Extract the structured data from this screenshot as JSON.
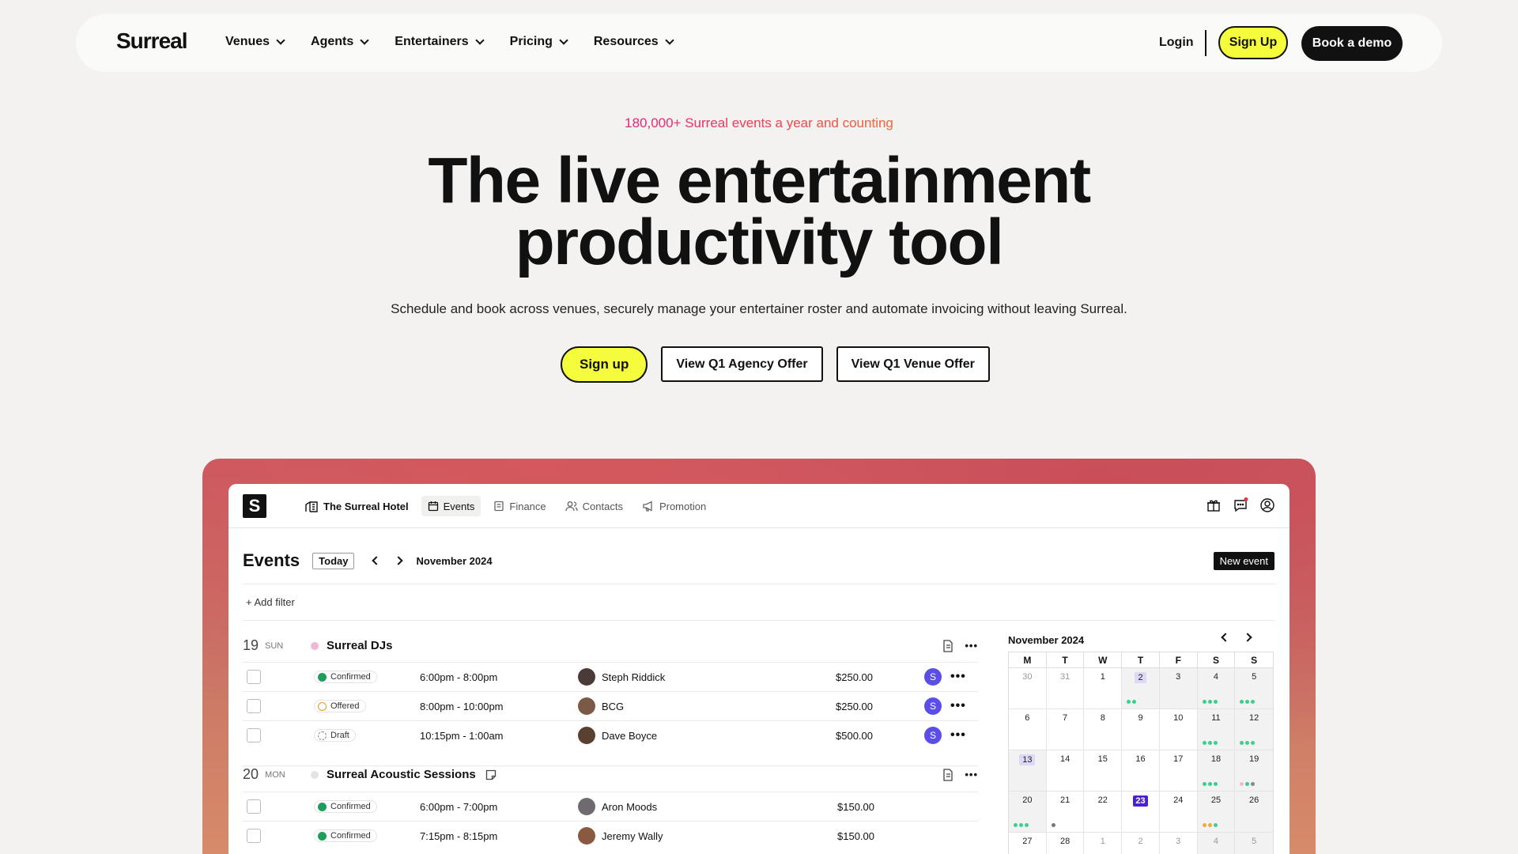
{
  "nav": {
    "logo": "Surreal",
    "items": [
      "Venues",
      "Agents",
      "Entertainers",
      "Pricing",
      "Resources"
    ],
    "login": "Login",
    "signup": "Sign Up",
    "demo": "Book a demo"
  },
  "hero": {
    "eyebrow": "180,000+ Surreal events a year and counting",
    "headline_1": "The live entertainment",
    "headline_2": "productivity tool",
    "sub": "Schedule and book across venues, securely manage your entertainer roster and automate invoicing without leaving Surreal.",
    "cta_signup": "Sign up",
    "cta_agency": "View Q1 Agency Offer",
    "cta_venue": "View Q1 Venue Offer"
  },
  "app": {
    "logo": "S",
    "venue": "The Surreal Hotel",
    "tabs": [
      "Events",
      "Finance",
      "Contacts",
      "Promotion"
    ],
    "events_title": "Events",
    "today": "Today",
    "month": "November 2024",
    "new_event": "New event",
    "add_filter": "+ Add filter",
    "days": [
      {
        "num": "19",
        "dow": "SUN",
        "name": "Surreal DJs",
        "dot": "#f4b6d8",
        "rows": [
          {
            "status": "Confirmed",
            "time": "6:00pm - 8:00pm",
            "person": "Steph Riddick",
            "price": "$250.00",
            "badge": "S"
          },
          {
            "status": "Offered",
            "time": "8:00pm - 10:00pm",
            "person": "BCG",
            "price": "$250.00",
            "badge": "S"
          },
          {
            "status": "Draft",
            "time": "10:15pm - 1:00am",
            "person": "Dave Boyce",
            "price": "$500.00",
            "badge": "S"
          }
        ]
      },
      {
        "num": "20",
        "dow": "MON",
        "name": "Surreal Acoustic Sessions",
        "dot": "#e3e3e3",
        "rows": [
          {
            "status": "Confirmed",
            "time": "6:00pm - 7:00pm",
            "person": "Aron Moods",
            "price": "$150.00"
          },
          {
            "status": "Confirmed",
            "time": "7:15pm - 8:15pm",
            "person": "Jeremy Wally",
            "price": "$150.00"
          }
        ]
      }
    ],
    "more": "•••",
    "calendar": {
      "title": "November 2024",
      "headers": [
        "M",
        "T",
        "W",
        "T",
        "F",
        "S",
        "S"
      ],
      "weeks": [
        [
          "30",
          "31",
          "1",
          "2",
          "3",
          "4",
          "5"
        ],
        [
          "6",
          "7",
          "8",
          "9",
          "10",
          "11",
          "12"
        ],
        [
          "13",
          "14",
          "15",
          "16",
          "17",
          "18",
          "19"
        ],
        [
          "20",
          "21",
          "22",
          "23",
          "24",
          "25",
          "26"
        ],
        [
          "27",
          "28",
          "1",
          "2",
          "3",
          "4",
          "5"
        ]
      ]
    }
  }
}
